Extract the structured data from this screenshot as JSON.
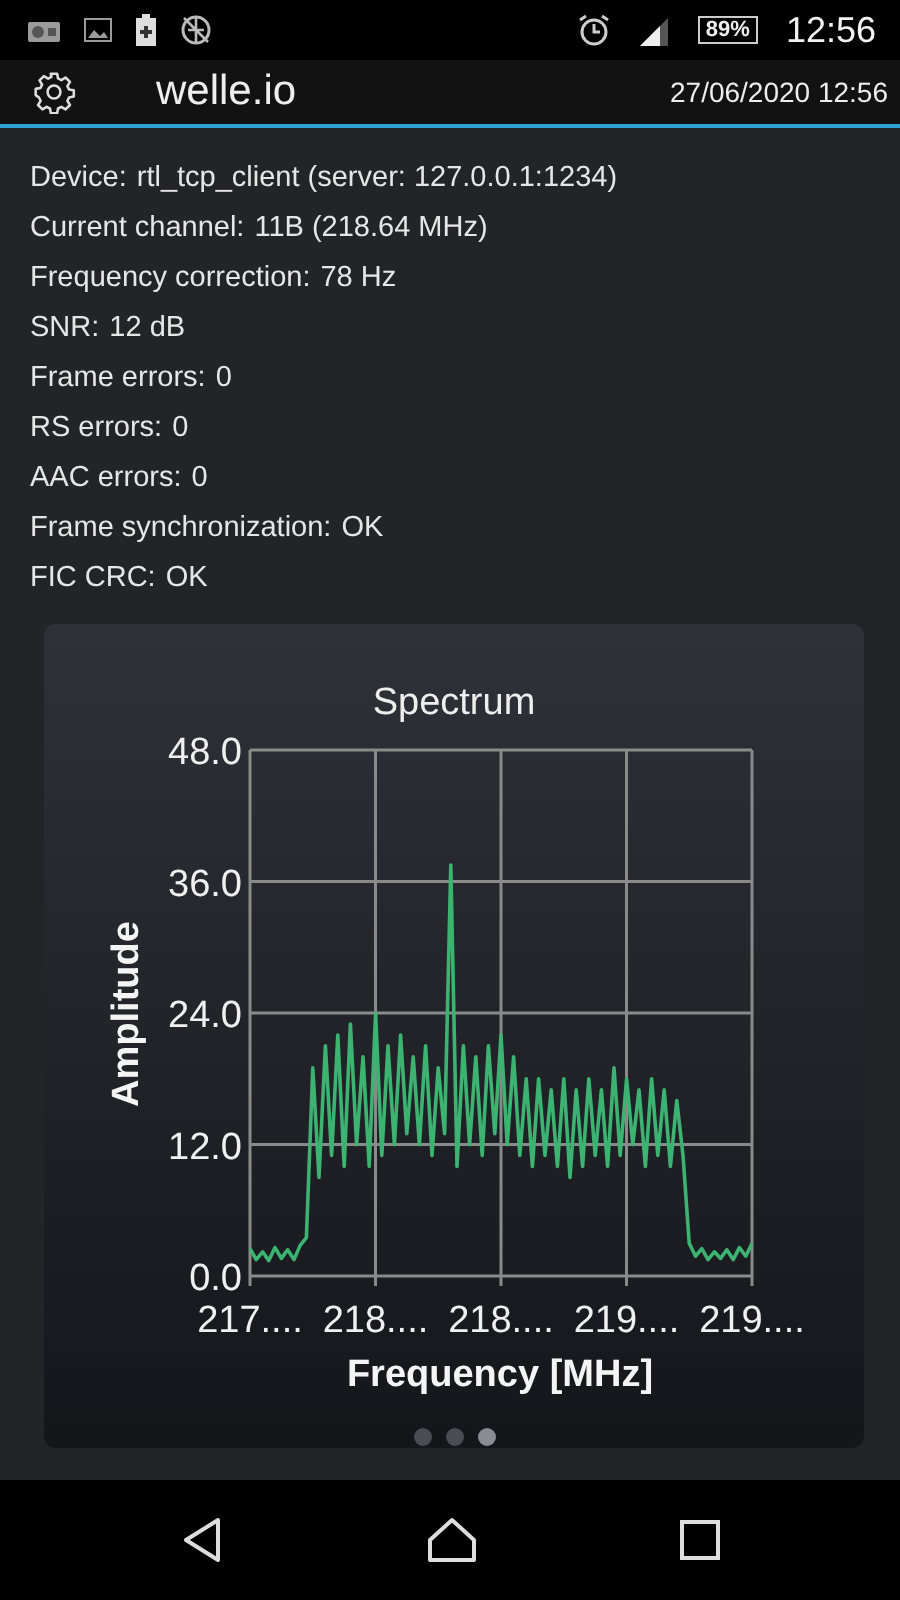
{
  "status_bar": {
    "battery": "89%",
    "time": "12:56"
  },
  "app_bar": {
    "title": "welle.io",
    "datetime": "27/06/2020 12:56"
  },
  "info": [
    {
      "label": "Device:",
      "value": "rtl_tcp_client (server: 127.0.0.1:1234)"
    },
    {
      "label": "Current channel:",
      "value": "11B (218.64 MHz)"
    },
    {
      "label": "Frequency correction:",
      "value": "78 Hz"
    },
    {
      "label": "SNR:",
      "value": "12 dB"
    },
    {
      "label": "Frame errors:",
      "value": "0"
    },
    {
      "label": "RS errors:",
      "value": "0"
    },
    {
      "label": "AAC errors:",
      "value": "0"
    },
    {
      "label": "Frame synchronization:",
      "value": "OK"
    },
    {
      "label": "FIC CRC:",
      "value": "OK"
    }
  ],
  "spectrum": {
    "chart_data": {
      "type": "line",
      "title": "Spectrum",
      "xlabel": "Frequency [MHz]",
      "ylabel": "Amplitude",
      "grid": true,
      "ylim": [
        0,
        48
      ],
      "yticks": [
        {
          "value": 48,
          "label": "48.0"
        },
        {
          "value": 36,
          "label": "36.0"
        },
        {
          "value": 24,
          "label": "24.0"
        },
        {
          "value": 12,
          "label": "12.0"
        },
        {
          "value": 0,
          "label": "0.0"
        }
      ],
      "categories": [
        "217....",
        null,
        null,
        null,
        null,
        null,
        null,
        null,
        null,
        null,
        null,
        null,
        null,
        null,
        null,
        null,
        null,
        null,
        null,
        null,
        "218....",
        null,
        null,
        null,
        null,
        null,
        null,
        null,
        null,
        null,
        null,
        null,
        null,
        null,
        null,
        null,
        null,
        null,
        null,
        null,
        "218....",
        null,
        null,
        null,
        null,
        null,
        null,
        null,
        null,
        null,
        null,
        null,
        null,
        null,
        null,
        null,
        null,
        null,
        null,
        null,
        "219....",
        null,
        null,
        null,
        null,
        null,
        null,
        null,
        null,
        null,
        null,
        null,
        null,
        null,
        null,
        null,
        null,
        null,
        null,
        null,
        "219...."
      ],
      "series": [
        {
          "color": "#3cb371",
          "values": [
            2.5,
            1.5,
            2.2,
            1.4,
            2.6,
            1.6,
            2.4,
            1.5,
            2.8,
            3.5,
            19,
            9,
            21,
            11,
            22,
            10,
            23,
            12,
            20,
            10,
            24,
            11,
            21,
            12,
            22,
            13,
            20,
            12,
            21,
            11,
            19,
            13,
            37.5,
            10,
            21,
            12,
            20,
            11,
            21,
            13,
            22,
            12,
            20,
            11,
            18,
            10,
            18,
            11,
            17,
            10,
            18,
            9,
            17,
            10,
            18,
            11,
            17,
            10,
            19,
            11,
            18,
            12,
            17,
            10,
            18,
            11,
            17,
            10,
            16,
            11,
            3,
            1.8,
            2.5,
            1.5,
            2.2,
            1.6,
            2.4,
            1.5,
            2.6,
            1.8,
            3.0
          ]
        }
      ]
    }
  },
  "pager": [
    {
      "selected": false
    },
    {
      "selected": false
    },
    {
      "selected": true
    }
  ]
}
